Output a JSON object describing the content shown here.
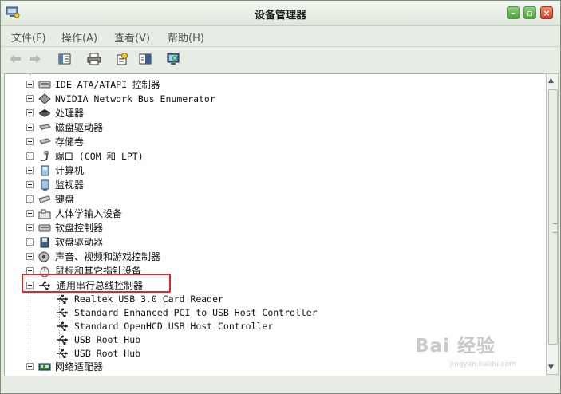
{
  "window": {
    "title": "设备管理器",
    "buttons": [
      "minimize",
      "maximize",
      "close"
    ]
  },
  "menu": [
    {
      "label": "文件(F)"
    },
    {
      "label": "操作(A)"
    },
    {
      "label": "查看(V)"
    },
    {
      "label": "帮助(H)"
    }
  ],
  "toolbar": {
    "icons": [
      "back-icon",
      "forward-icon",
      "properties-icon",
      "print-icon",
      "help-icon",
      "show-hide-console-tree-icon",
      "scan-hardware-icon"
    ]
  },
  "tree": {
    "items": [
      {
        "label": "IDE ATA/ATAPI 控制器",
        "icon": "ide-controller-icon",
        "expanded": false
      },
      {
        "label": "NVIDIA Network Bus Enumerator",
        "icon": "network-bus-icon",
        "expanded": false
      },
      {
        "label": "处理器",
        "icon": "processor-icon",
        "expanded": false
      },
      {
        "label": "磁盘驱动器",
        "icon": "disk-drive-icon",
        "expanded": false
      },
      {
        "label": "存储卷",
        "icon": "storage-volume-icon",
        "expanded": false
      },
      {
        "label": "端口 (COM 和 LPT)",
        "icon": "port-icon",
        "expanded": false
      },
      {
        "label": "计算机",
        "icon": "computer-icon",
        "expanded": false
      },
      {
        "label": "监视器",
        "icon": "monitor-icon",
        "expanded": false
      },
      {
        "label": "键盘",
        "icon": "keyboard-icon",
        "expanded": false
      },
      {
        "label": "人体学输入设备",
        "icon": "hid-icon",
        "expanded": false
      },
      {
        "label": "软盘控制器",
        "icon": "floppy-controller-icon",
        "expanded": false
      },
      {
        "label": "软盘驱动器",
        "icon": "floppy-drive-icon",
        "expanded": false
      },
      {
        "label": "声音、视频和游戏控制器",
        "icon": "sound-icon",
        "expanded": false
      },
      {
        "label": "鼠标和其它指针设备",
        "icon": "mouse-icon",
        "expanded": false
      },
      {
        "label": "通用串行总线控制器",
        "icon": "usb-icon",
        "expanded": true,
        "children": [
          {
            "label": "Realtek USB 3.0 Card Reader"
          },
          {
            "label": "Standard Enhanced PCI to USB Host Controller"
          },
          {
            "label": "Standard OpenHCD USB Host Controller"
          },
          {
            "label": "USB Root Hub"
          },
          {
            "label": "USB Root Hub"
          }
        ]
      },
      {
        "label": "网络适配器",
        "icon": "network-adapter-icon",
        "expanded": false
      }
    ]
  },
  "watermark": {
    "main": "Bai 经验",
    "sub": "jingyan.baidu.com"
  },
  "colors": {
    "highlight_box": "#d82a2a",
    "title_bar": "#dfe7db",
    "window_bg": "#e7ece4"
  }
}
